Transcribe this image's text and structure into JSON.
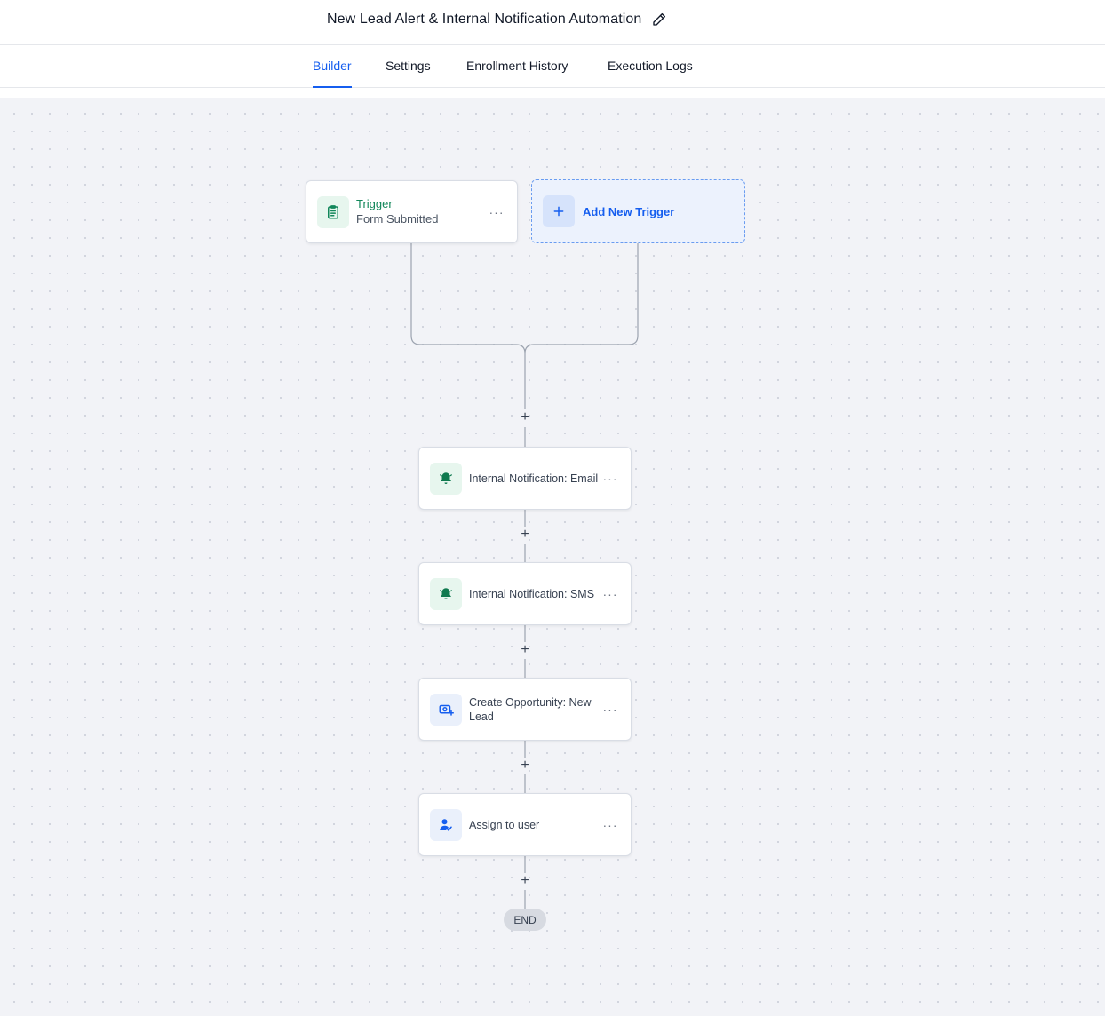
{
  "header": {
    "title": "New Lead Alert & Internal Notification Automation",
    "edit_icon": "pencil-icon"
  },
  "tabs": [
    {
      "label": "Builder",
      "active": true
    },
    {
      "label": "Settings",
      "active": false
    },
    {
      "label": "Enrollment History",
      "active": false
    },
    {
      "label": "Execution Logs",
      "active": false
    }
  ],
  "trigger": {
    "title": "Trigger",
    "subtitle": "Form Submitted",
    "icon": "clipboard-icon",
    "menu": "···"
  },
  "add_trigger": {
    "label": "Add New Trigger",
    "icon": "plus-icon"
  },
  "actions": [
    {
      "label": "Internal Notification: Email",
      "icon": "bell-icon",
      "menu": "···"
    },
    {
      "label": "Internal Notification: SMS",
      "icon": "bell-icon",
      "menu": "···"
    },
    {
      "label": "Create Opportunity: New Lead",
      "icon": "opportunity-icon",
      "menu": "···"
    },
    {
      "label": "Assign to user",
      "icon": "user-assign-icon",
      "menu": "···"
    }
  ],
  "add_step_symbol": "+",
  "end_label": "END",
  "colors": {
    "accent": "#155eef",
    "green": "#12875a",
    "canvas": "#f2f3f7"
  }
}
